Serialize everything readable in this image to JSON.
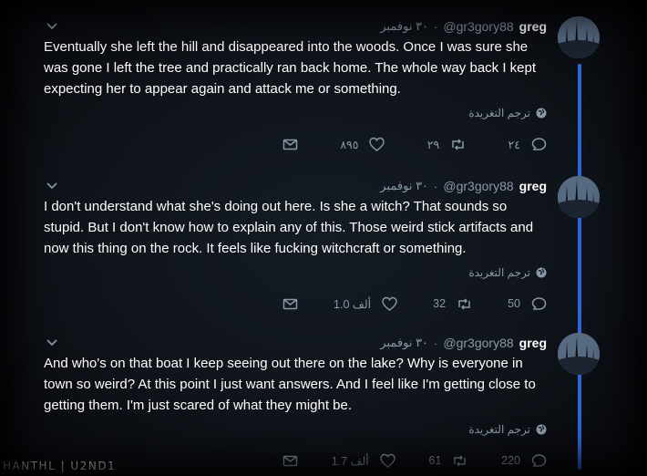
{
  "tweets": [
    {
      "name": "greg",
      "handle": "@gr3gory88",
      "separator": "·",
      "date": "٣٠ نوفمبر",
      "text": "Eventually she left the hill and disappeared into the woods. Once I was sure she was gone I left the tree and practically ran back home. The whole way back I kept expecting her to appear again and attack me or something.",
      "translate": "ترجم التغريدة",
      "replies": "٢٤",
      "retweets": "٢٩",
      "likes": "٨٩٥"
    },
    {
      "name": "greg",
      "handle": "@gr3gory88",
      "separator": "·",
      "date": "٣٠ نوفمبر",
      "text": "I don't understand what she's doing out here. Is she a witch? That sounds so stupid. But I don't know how to explain any of this. Those weird stick artifacts and now this thing on the rock. It feels like fucking witchcraft or something.",
      "translate": "ترجم التغريدة",
      "replies": "50",
      "retweets": "32",
      "likes": "1.0 ألف"
    },
    {
      "name": "greg",
      "handle": "@gr3gory88",
      "separator": "·",
      "date": "٣٠ نوفمبر",
      "text": "And who's on that boat I keep seeing out there on the lake? Why is everyone in town so weird? At this point I just want answers. And I feel like I'm getting close to getting them. I'm just scared of what they might be.",
      "translate": "ترجم التغريدة",
      "replies": "220",
      "retweets": "61",
      "likes": "1.7 ألف"
    }
  ],
  "colors": {
    "accent": "#2a66d9",
    "muted": "#8899a6",
    "text": "#ffffff"
  },
  "icons": [
    "chevron-down-icon",
    "globe-icon",
    "reply-icon",
    "retweet-icon",
    "like-icon",
    "message-icon"
  ],
  "footer": {
    "credit": "HANTHL | U2ND1"
  }
}
